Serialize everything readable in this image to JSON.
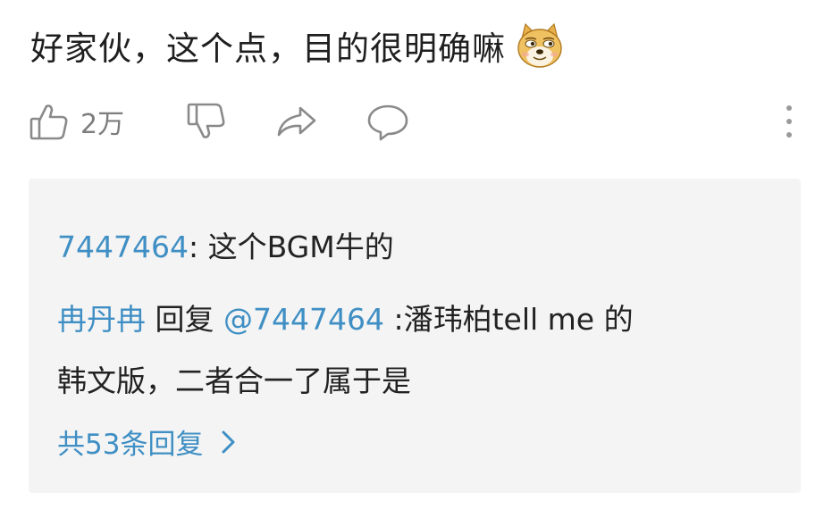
{
  "comment": {
    "text": "好家伙，这个点，目的很明确嘛",
    "emoji_icon": "doge-emoji-icon"
  },
  "actions": {
    "like_count": "2万",
    "icons": [
      "thumbs-up-icon",
      "thumbs-down-icon",
      "share-icon",
      "comment-icon",
      "more-vertical-icon"
    ]
  },
  "replies": [
    {
      "user": "7447464",
      "separator": ": ",
      "text": "这个BGM牛的"
    },
    {
      "user": "冉丹冉",
      "reply_word": " 回复 ",
      "mention": "@7447464",
      "text_line1": " :潘玮柏tell me 的",
      "text_line2": "韩文版，二者合一了属于是"
    }
  ],
  "more_replies": {
    "label": "共53条回复"
  },
  "colors": {
    "link_blue": "#3f8fc4",
    "icon_gray": "#8a8a8a",
    "reply_bg": "#f4f4f4"
  }
}
